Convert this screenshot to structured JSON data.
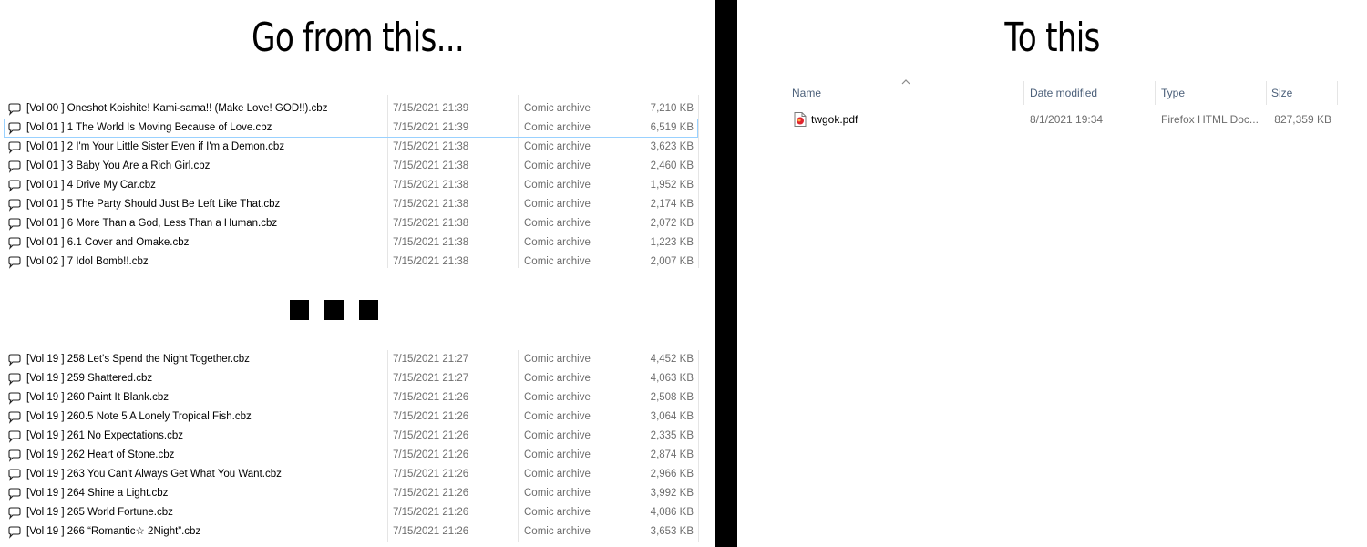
{
  "left": {
    "heading": "Go from this...",
    "top_files": [
      {
        "name": "[Vol 00 ]  Oneshot Koishite! Kami-sama!! (Make Love! GOD!!).cbz",
        "date": "7/15/2021 21:39",
        "type": "Comic archive",
        "size": "7,210 KB"
      },
      {
        "name": "[Vol 01 ] 1 The World Is Moving Because of Love.cbz",
        "date": "7/15/2021 21:39",
        "type": "Comic archive",
        "size": "6,519 KB",
        "selected": true
      },
      {
        "name": "[Vol 01 ] 2 I'm Your Little Sister Even if I'm a Demon.cbz",
        "date": "7/15/2021 21:38",
        "type": "Comic archive",
        "size": "3,623 KB"
      },
      {
        "name": "[Vol 01 ] 3 Baby You Are a Rich Girl.cbz",
        "date": "7/15/2021 21:38",
        "type": "Comic archive",
        "size": "2,460 KB"
      },
      {
        "name": "[Vol 01 ] 4 Drive My Car.cbz",
        "date": "7/15/2021 21:38",
        "type": "Comic archive",
        "size": "1,952 KB"
      },
      {
        "name": "[Vol 01 ] 5 The Party Should Just Be Left Like That.cbz",
        "date": "7/15/2021 21:38",
        "type": "Comic archive",
        "size": "2,174 KB"
      },
      {
        "name": "[Vol 01 ] 6 More Than a God, Less Than a Human.cbz",
        "date": "7/15/2021 21:38",
        "type": "Comic archive",
        "size": "2,072 KB"
      },
      {
        "name": "[Vol 01 ] 6.1 Cover and Omake.cbz",
        "date": "7/15/2021 21:38",
        "type": "Comic archive",
        "size": "1,223 KB"
      },
      {
        "name": "[Vol 02 ] 7 Idol Bomb!!.cbz",
        "date": "7/15/2021 21:38",
        "type": "Comic archive",
        "size": "2,007 KB"
      }
    ],
    "bottom_files": [
      {
        "name": "[Vol 19 ] 258 Let's Spend the Night Together.cbz",
        "date": "7/15/2021 21:27",
        "type": "Comic archive",
        "size": "4,452 KB"
      },
      {
        "name": "[Vol 19 ] 259 Shattered.cbz",
        "date": "7/15/2021 21:27",
        "type": "Comic archive",
        "size": "4,063 KB"
      },
      {
        "name": "[Vol 19 ] 260 Paint It Blank.cbz",
        "date": "7/15/2021 21:26",
        "type": "Comic archive",
        "size": "2,508 KB"
      },
      {
        "name": "[Vol 19 ] 260.5 Note 5 A Lonely Tropical Fish.cbz",
        "date": "7/15/2021 21:26",
        "type": "Comic archive",
        "size": "3,064 KB"
      },
      {
        "name": "[Vol 19 ] 261 No Expectations.cbz",
        "date": "7/15/2021 21:26",
        "type": "Comic archive",
        "size": "2,335 KB"
      },
      {
        "name": "[Vol 19 ] 262 Heart of Stone.cbz",
        "date": "7/15/2021 21:26",
        "type": "Comic archive",
        "size": "2,874 KB"
      },
      {
        "name": "[Vol 19 ] 263 You Can't Always Get What You Want.cbz",
        "date": "7/15/2021 21:26",
        "type": "Comic archive",
        "size": "2,966 KB"
      },
      {
        "name": "[Vol 19 ] 264 Shine a Light.cbz",
        "date": "7/15/2021 21:26",
        "type": "Comic archive",
        "size": "3,992 KB"
      },
      {
        "name": "[Vol 19 ] 265 World Fortune.cbz",
        "date": "7/15/2021 21:26",
        "type": "Comic archive",
        "size": "4,086 KB"
      },
      {
        "name": "[Vol 19 ] 266 “Romantic☆ 2Night”.cbz",
        "date": "7/15/2021 21:26",
        "type": "Comic archive",
        "size": "3,653 KB"
      }
    ],
    "file_icon": "speech-bubble-icon"
  },
  "right": {
    "heading": "To this",
    "columns": {
      "name": "Name",
      "date": "Date modified",
      "type": "Type",
      "size": "Size"
    },
    "file": {
      "name": "twgok.pdf",
      "date": "8/1/2021 19:34",
      "type": "Firefox HTML Doc...",
      "size": "827,359 KB",
      "icon": "pdf-file-icon"
    }
  },
  "colors": {
    "selection_border": "#99d1ff",
    "header_text": "#4c607a",
    "meta_text": "#6d6d6d",
    "divider": "#000000",
    "pdf_red": "#e0232e"
  }
}
